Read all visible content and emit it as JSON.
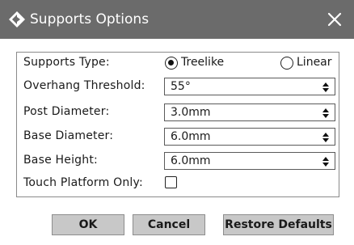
{
  "window": {
    "title": "Supports Options",
    "app_icon": "diamond-logo-icon",
    "close_icon": "close-icon"
  },
  "form": {
    "supports_type": {
      "label": "Supports Type:",
      "options": [
        {
          "label": "Treelike",
          "selected": true
        },
        {
          "label": "Linear",
          "selected": false
        }
      ]
    },
    "overhang_threshold": {
      "label": "Overhang Threshold:",
      "value": "55°"
    },
    "post_diameter": {
      "label": "Post Diameter:",
      "value": "3.0mm"
    },
    "base_diameter": {
      "label": "Base Diameter:",
      "value": "6.0mm"
    },
    "base_height": {
      "label": "Base Height:",
      "value": "6.0mm"
    },
    "touch_platform_only": {
      "label": "Touch Platform Only:",
      "checked": false
    }
  },
  "buttons": {
    "ok": "OK",
    "cancel": "Cancel",
    "restore_defaults": "Restore Defaults"
  },
  "colors": {
    "titlebar": "#6b6b6b",
    "button_face": "#c8c8c8"
  }
}
